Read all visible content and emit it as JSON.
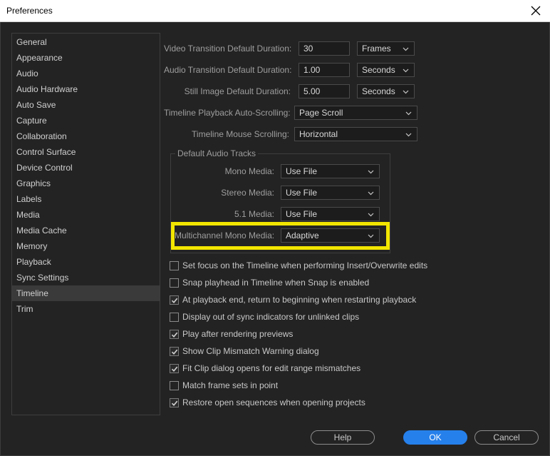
{
  "window": {
    "title": "Preferences"
  },
  "sidebar": {
    "items": [
      {
        "label": "General"
      },
      {
        "label": "Appearance"
      },
      {
        "label": "Audio"
      },
      {
        "label": "Audio Hardware"
      },
      {
        "label": "Auto Save"
      },
      {
        "label": "Capture"
      },
      {
        "label": "Collaboration"
      },
      {
        "label": "Control Surface"
      },
      {
        "label": "Device Control"
      },
      {
        "label": "Graphics"
      },
      {
        "label": "Labels"
      },
      {
        "label": "Media"
      },
      {
        "label": "Media Cache"
      },
      {
        "label": "Memory"
      },
      {
        "label": "Playback"
      },
      {
        "label": "Sync Settings"
      },
      {
        "label": "Timeline"
      },
      {
        "label": "Trim"
      }
    ],
    "selected": "Timeline"
  },
  "durations": {
    "video": {
      "label": "Video Transition Default Duration:",
      "value": "30",
      "unit": "Frames"
    },
    "audio": {
      "label": "Audio Transition Default Duration:",
      "value": "1.00",
      "unit": "Seconds"
    },
    "still": {
      "label": "Still Image Default Duration:",
      "value": "5.00",
      "unit": "Seconds"
    }
  },
  "scrolling": {
    "playback": {
      "label": "Timeline Playback Auto-Scrolling:",
      "value": "Page Scroll"
    },
    "mouse": {
      "label": "Timeline Mouse Scrolling:",
      "value": "Horizontal"
    }
  },
  "audio_tracks": {
    "title": "Default Audio Tracks",
    "mono": {
      "label": "Mono Media:",
      "value": "Use File"
    },
    "stereo": {
      "label": "Stereo Media:",
      "value": "Use File"
    },
    "five_one": {
      "label": "5.1 Media:",
      "value": "Use File"
    },
    "multichannel": {
      "label": "Multichannel Mono Media:",
      "value": "Adaptive"
    },
    "highlight_color": "#f2e600"
  },
  "options": [
    {
      "label": "Set focus on the Timeline when performing Insert/Overwrite edits",
      "checked": false
    },
    {
      "label": "Snap playhead in Timeline when Snap is enabled",
      "checked": false
    },
    {
      "label": "At playback end, return to beginning when restarting playback",
      "checked": true
    },
    {
      "label": "Display out of sync indicators for unlinked clips",
      "checked": false
    },
    {
      "label": "Play after rendering previews",
      "checked": true
    },
    {
      "label": "Show Clip Mismatch Warning dialog",
      "checked": true
    },
    {
      "label": "Fit Clip dialog opens for edit range mismatches",
      "checked": true
    },
    {
      "label": "Match frame sets in point",
      "checked": false
    },
    {
      "label": "Restore open sequences when opening projects",
      "checked": true
    }
  ],
  "buttons": {
    "help": "Help",
    "ok": "OK",
    "cancel": "Cancel"
  },
  "colors": {
    "accent": "#2680eb",
    "background": "#232323"
  }
}
